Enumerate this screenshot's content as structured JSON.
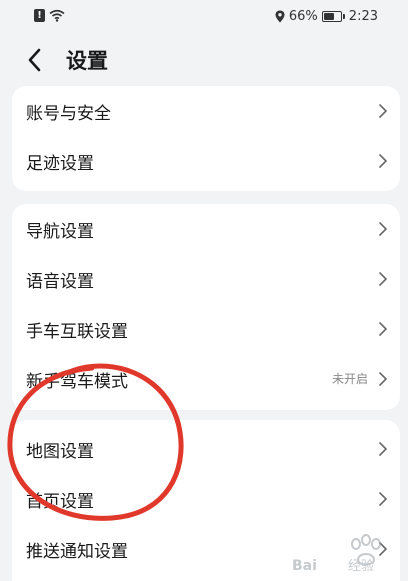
{
  "status_bar": {
    "battery_percent": "66%",
    "time": "2:23"
  },
  "header": {
    "title": "设置"
  },
  "groups": [
    {
      "items": [
        {
          "label": "账号与安全"
        },
        {
          "label": "足迹设置"
        }
      ]
    },
    {
      "items": [
        {
          "label": "导航设置"
        },
        {
          "label": "语音设置"
        },
        {
          "label": "手车互联设置"
        },
        {
          "label": "新手驾车模式",
          "value": "未开启"
        }
      ]
    },
    {
      "items": [
        {
          "label": "地图设置"
        },
        {
          "label": "首页设置"
        },
        {
          "label": "推送通知设置"
        }
      ]
    }
  ],
  "annotation": {
    "circle_color": "#e0392b"
  },
  "watermark": {
    "text": "Baidu 经验"
  }
}
